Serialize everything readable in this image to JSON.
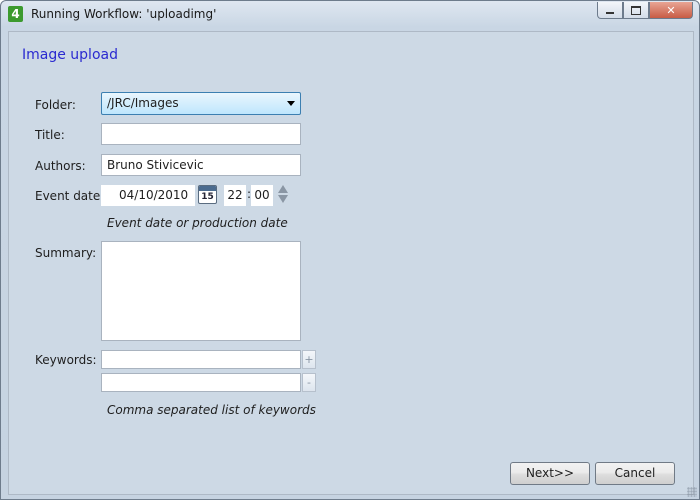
{
  "window": {
    "title": "Running Workflow: 'uploadimg'",
    "app_icon_glyph": "4",
    "controls": {
      "minimize": "minimize-icon",
      "maximize": "maximize-icon",
      "close_glyph": "✕"
    }
  },
  "form": {
    "heading": "Image upload",
    "folder": {
      "label": "Folder:",
      "value": "/JRC/Images"
    },
    "title": {
      "label": "Title:",
      "value": ""
    },
    "authors": {
      "label": "Authors:",
      "value": "Bruno Stivicevic"
    },
    "event_date": {
      "label": "Event date:",
      "date": "04/10/2010",
      "calendar_day": "15",
      "hour": "22",
      "separator": ":",
      "minute": "00",
      "hint": "Event date or production date"
    },
    "summary": {
      "label": "Summary:",
      "value": ""
    },
    "keywords": {
      "label": "Keywords:",
      "add_label": "+",
      "remove_label": "-",
      "hint": "Comma separated list of keywords"
    }
  },
  "footer": {
    "next_label": "Next>>",
    "cancel_label": "Cancel"
  },
  "colors": {
    "heading": "#2a2ad0",
    "panel": "#cdd9e5",
    "select_accent": "#bee6fd"
  }
}
